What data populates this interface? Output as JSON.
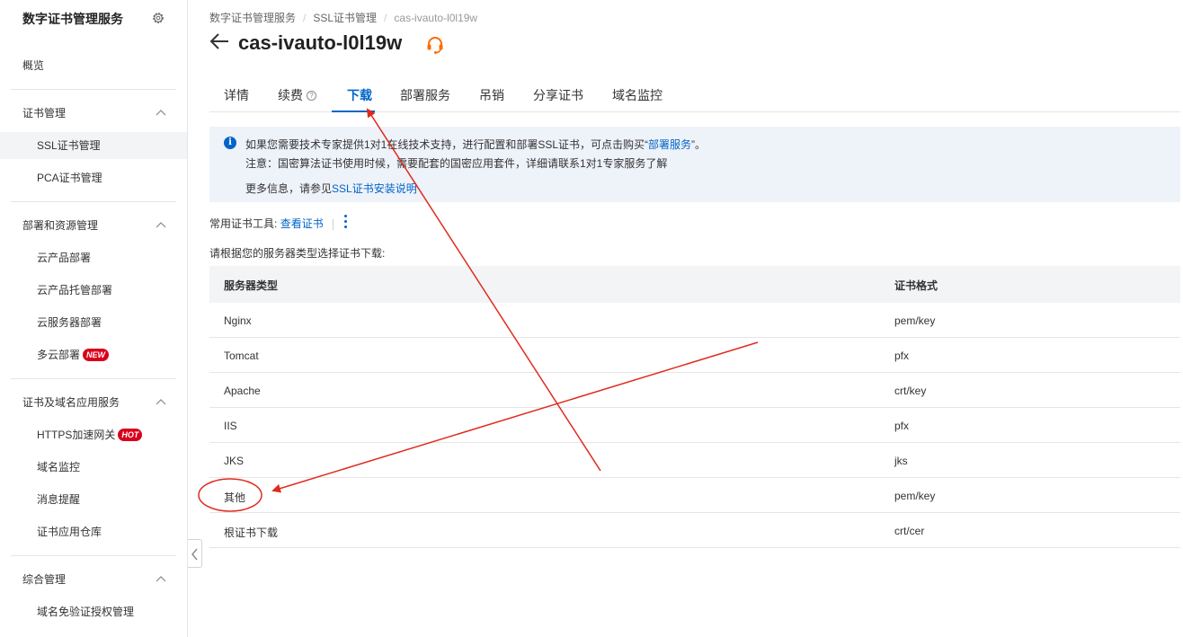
{
  "sidebar": {
    "title": "数字证书管理服务",
    "items": [
      {
        "label": "概览"
      },
      {
        "label": "证书管理"
      },
      {
        "label": "SSL证书管理"
      },
      {
        "label": "PCA证书管理"
      },
      {
        "label": "部署和资源管理"
      },
      {
        "label": "云产品部署"
      },
      {
        "label": "云产品托管部署"
      },
      {
        "label": "云服务器部署"
      },
      {
        "label": "多云部署",
        "badge": "NEW"
      },
      {
        "label": "证书及域名应用服务"
      },
      {
        "label": "HTTPS加速网关",
        "badge": "HOT"
      },
      {
        "label": "域名监控"
      },
      {
        "label": "消息提醒"
      },
      {
        "label": "证书应用仓库"
      },
      {
        "label": "综合管理"
      },
      {
        "label": "域名免验证授权管理"
      }
    ]
  },
  "breadcrumb": [
    "数字证书管理服务",
    "SSL证书管理",
    "cas-ivauto-l0l19w"
  ],
  "page_title": "cas-ivauto-l0l19w",
  "tabs": [
    {
      "label": "详情"
    },
    {
      "label": "续费"
    },
    {
      "label": "下载"
    },
    {
      "label": "部署服务"
    },
    {
      "label": "吊销"
    },
    {
      "label": "分享证书"
    },
    {
      "label": "域名监控"
    }
  ],
  "notice": {
    "line1_prefix": "如果您需要技术专家提供1对1在线技术支持，进行配置和部署SSL证书，可点击购买“",
    "line1_link": "部署服务",
    "line1_suffix": "”。",
    "line2": "注意：国密算法证书使用时候，需要配套的国密应用套件，详细请联系1对1专家服务了解",
    "line3_prefix": "更多信息，请参见",
    "line3_link": "SSL证书安装说明"
  },
  "tools": {
    "label": "常用证书工具:",
    "link": "查看证书"
  },
  "prompt": "请根据您的服务器类型选择证书下载:",
  "table": {
    "headers": [
      "服务器类型",
      "证书格式"
    ],
    "rows": [
      [
        "Nginx",
        "pem/key"
      ],
      [
        "Tomcat",
        "pfx"
      ],
      [
        "Apache",
        "crt/key"
      ],
      [
        "IIS",
        "pfx"
      ],
      [
        "JKS",
        "jks"
      ],
      [
        "其他",
        "pem/key"
      ],
      [
        "根证书下载",
        "crt/cer"
      ]
    ]
  },
  "colors": {
    "accent": "#0064c8",
    "annotation": "#e02a1e",
    "badge": "#d9001b",
    "notice_bg": "#eef2f9"
  }
}
